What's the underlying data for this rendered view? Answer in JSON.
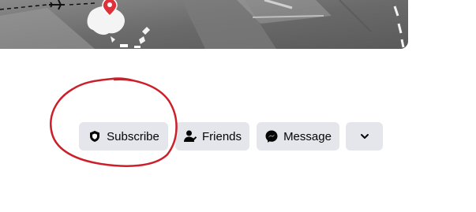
{
  "profile_actions": {
    "subscribe_label": "Subscribe",
    "friends_label": "Friends",
    "message_label": "Message",
    "more_icon": "chevron-down-icon",
    "subscribe_icon": "shield-icon",
    "friends_icon": "person-check-icon",
    "message_icon": "messenger-icon"
  },
  "colors": {
    "button_bg": "#e4e6eb",
    "text": "#050505",
    "annotation": "#cc1f2a",
    "map_pin": "#e0313a"
  },
  "annotation": {
    "shape": "hand-drawn circle",
    "target": "subscribe-button"
  }
}
